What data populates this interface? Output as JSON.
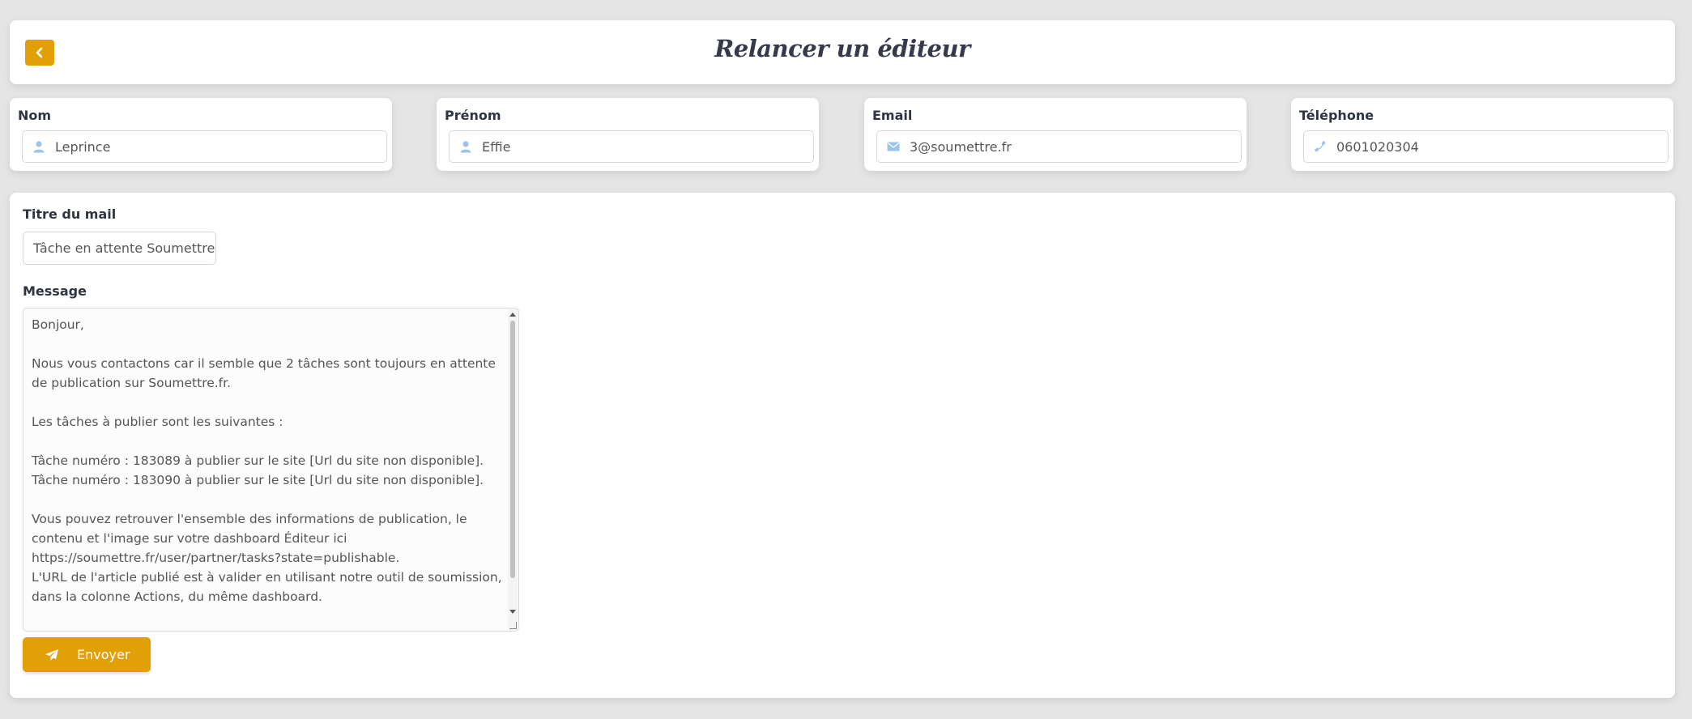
{
  "header": {
    "title": "Relancer un éditeur",
    "back_icon": "chevron-left-icon"
  },
  "fields": {
    "nom": {
      "label": "Nom",
      "value": "Leprince",
      "icon": "user-icon"
    },
    "prenom": {
      "label": "Prénom",
      "value": "Effie",
      "icon": "user-icon"
    },
    "email": {
      "label": "Email",
      "value": "3@soumettre.fr",
      "icon": "envelope-icon"
    },
    "telephone": {
      "label": "Téléphone",
      "value": "0601020304",
      "icon": "phone-icon"
    }
  },
  "mail": {
    "title_label": "Titre du mail",
    "title_value": "Tâche en attente Soumettre.f",
    "message_label": "Message",
    "message_text": "Bonjour,\n\nNous vous contactons car il semble que 2 tâches sont toujours en attente de publication sur Soumettre.fr.\n\nLes tâches à publier sont les suivantes :\n\nTâche numéro : 183089 à publier sur le site [Url du site non disponible].\nTâche numéro : 183090 à publier sur le site [Url du site non disponible].\n\nVous pouvez retrouver l'ensemble des informations de publication, le contenu et l'image sur votre dashboard Éditeur ici https://soumettre.fr/user/partner/tasks?state=publishable.\nL'URL de l'article publié est à valider en utilisant notre outil de soumission, dans la colonne Actions, du même dashboard.",
    "send_label": "Envoyer",
    "send_icon": "paper-plane-icon"
  },
  "colors": {
    "accent": "#e0a006",
    "background": "#e5e5e5",
    "card": "#ffffff",
    "icon_blue": "#9cc3ea"
  }
}
